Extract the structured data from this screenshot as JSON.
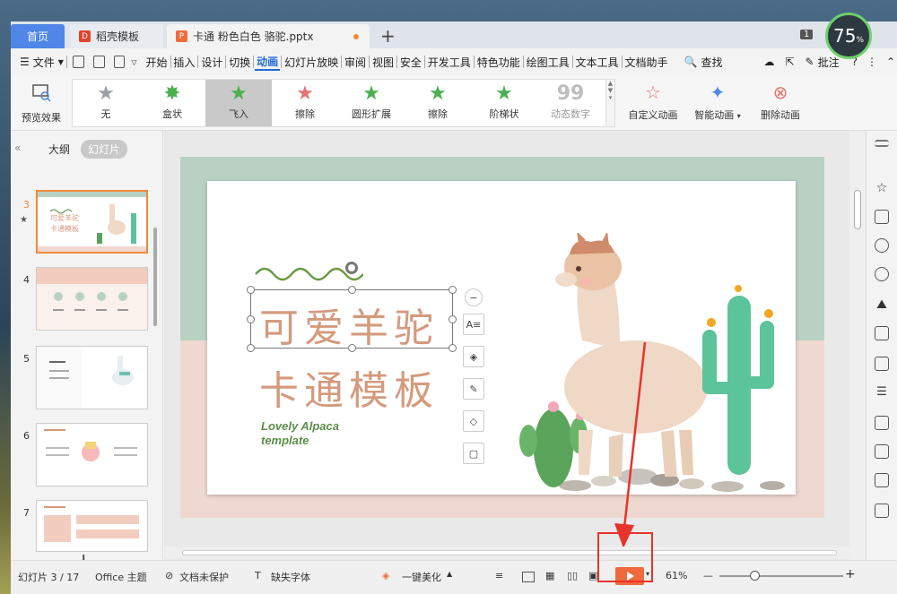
{
  "tabs": {
    "home": "首页",
    "templates": "稻壳模板",
    "active_doc": "卡通 粉色白色 骆驼.pptx",
    "badge": "1"
  },
  "menu": {
    "file": "文件",
    "items": [
      "开始",
      "插入",
      "设计",
      "切换",
      "动画",
      "幻灯片放映",
      "审阅",
      "视图",
      "安全",
      "开发工具",
      "特色功能",
      "绘图工具",
      "文本工具",
      "文档助手"
    ],
    "active": "动画",
    "search": "查找",
    "comment": "批注"
  },
  "ribbon": {
    "preview": "预览效果",
    "gallery": [
      {
        "label": "无",
        "color": "#9aa0a6"
      },
      {
        "label": "盒状",
        "color": "#4caf50"
      },
      {
        "label": "飞入",
        "color": "#4caf50"
      },
      {
        "label": "擦除",
        "color": "#e57373"
      },
      {
        "label": "圆形扩展",
        "color": "#4caf50"
      },
      {
        "label": "擦除",
        "color": "#4caf50"
      },
      {
        "label": "阶梯状",
        "color": "#4caf50"
      },
      {
        "label": "动态数字",
        "color": "#bdbdbd"
      }
    ],
    "selected": "飞入",
    "custom": "自定义动画",
    "smart": "智能动画",
    "delete": "删除动画"
  },
  "leftpanel": {
    "outline": "大纲",
    "slides": "幻灯片",
    "thumbs": [
      "3",
      "4",
      "5",
      "6",
      "7"
    ]
  },
  "slide": {
    "title1": "可爱羊驼",
    "title2": "卡通模板",
    "subtitle1": "Lovely Alpaca",
    "subtitle2": "template",
    "thumb3_line1": "可爱羊驼",
    "thumb3_line2": "卡通模板"
  },
  "status": {
    "slide_count": "幻灯片 3 / 17",
    "theme": "Office 主题",
    "protect": "文档未保护",
    "font": "缺失字体",
    "beautify": "一键美化",
    "zoom": "61%"
  },
  "clock": {
    "value": "75",
    "unit": "%"
  },
  "accent": {
    "brand": "#4f86e8",
    "play": "#f06a3c",
    "highlight": "#e8332a"
  }
}
